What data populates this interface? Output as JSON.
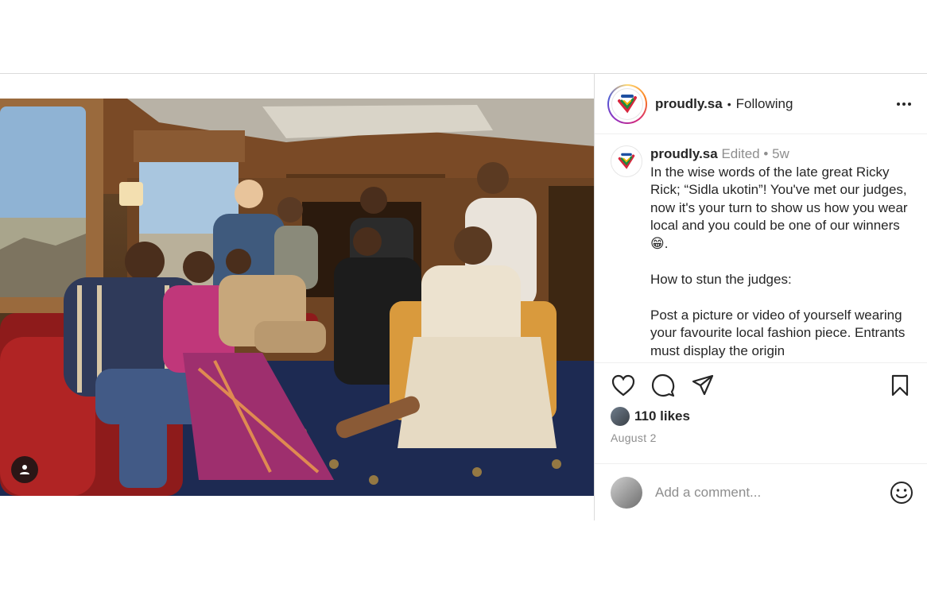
{
  "post": {
    "photo_alt": "",
    "username": "proudly.sa",
    "follow_state": "Following",
    "separator": "•",
    "caption": {
      "username": "proudly.sa",
      "edited": "Edited",
      "separator": "•",
      "time": "5w",
      "lines": [
        "In the wise words of the late great Ricky Rick; “Sidla ukotin”! You've met our judges, now it's your turn to show us how you wear local and you could be one of our winners😁.",
        "How to stun the judges:",
        "Post a picture or video of yourself wearing your favourite local fashion piece. Entrants must display the origin"
      ]
    },
    "likes": "110 likes",
    "date": "August 2",
    "comment_placeholder": "Add a comment..."
  },
  "icons": {
    "user_tag": "user-tag-icon",
    "more": "more-options-icon",
    "like": "heart-icon",
    "comment": "comment-icon",
    "share": "paper-plane-icon",
    "save": "bookmark-icon",
    "emoji": "emoji-icon"
  },
  "colors": {
    "border": "#dbdbdb",
    "text": "#262626",
    "muted": "#8e8e8e",
    "logo_red": "#d7263d",
    "logo_green": "#1f8a3b",
    "logo_yellow": "#f4b400",
    "logo_blue": "#1e4fa1"
  }
}
